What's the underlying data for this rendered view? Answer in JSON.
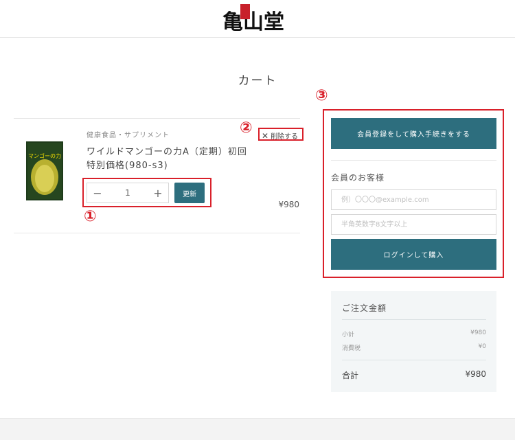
{
  "header": {
    "logo_text": "亀山堂",
    "logo_seal_text": "益健幸福"
  },
  "page": {
    "title": "カート"
  },
  "cart": {
    "item": {
      "category": "健康食品・サプリメント",
      "name_line1": "ワイルドマンゴーの力A（定期）初回",
      "name_line2": "特別価格(980-s3)",
      "package_label": "マンゴーの力",
      "remove_label": "削除する",
      "quantity": "1",
      "update_label": "更新",
      "price": "¥980"
    }
  },
  "annotations": [
    "①",
    "②",
    "③"
  ],
  "sidebar": {
    "register_button": "会員登録をして購入手続きをする",
    "member_title": "会員のお客様",
    "email_placeholder": "例）〇〇〇@example.com",
    "password_placeholder": "半角英数字8文字以上",
    "login_button": "ログインして購入"
  },
  "summary": {
    "title": "ご注文金額",
    "subtotal_label": "小計",
    "subtotal_value": "¥980",
    "tax_label": "消費税",
    "tax_value": "¥0",
    "total_label": "合計",
    "total_value": "¥980"
  },
  "colors": {
    "accent": "#2d6e7e",
    "annotation": "#d9202a",
    "summary_bg": "#f3f6f7"
  }
}
